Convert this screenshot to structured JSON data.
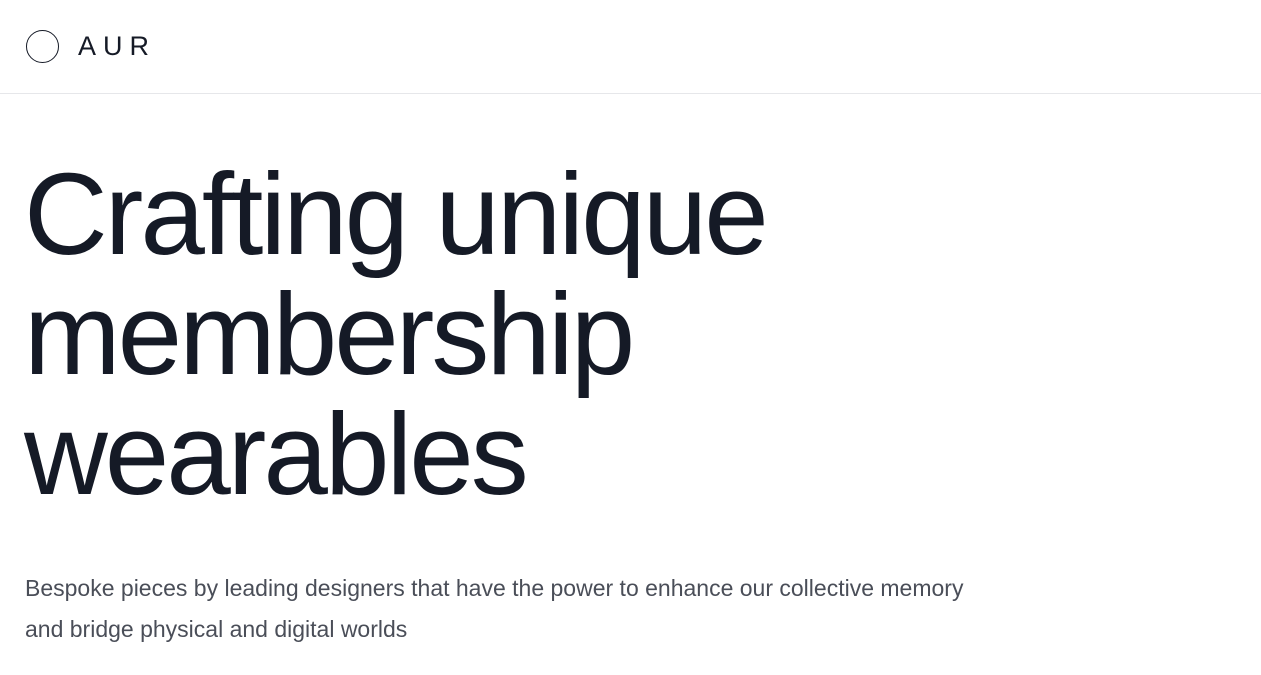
{
  "header": {
    "logo_text": "AUR"
  },
  "hero": {
    "headline_line1": "Crafting unique",
    "headline_line2": "membership",
    "headline_line3": "wearables",
    "subtext": "Bespoke pieces by leading designers that have the power to enhance our collective memory and bridge physical and digital worlds"
  }
}
